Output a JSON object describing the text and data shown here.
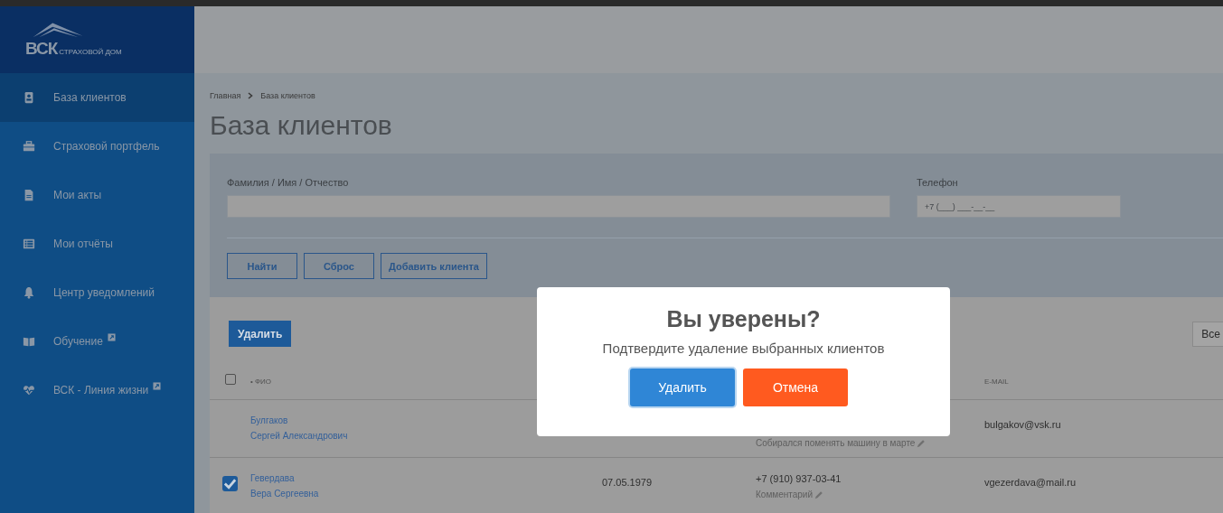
{
  "logo": {
    "mark": "ВСК",
    "subtitle": "СТРАХОВОЙ ДОМ"
  },
  "sidebar": {
    "items": [
      {
        "label": "База клиентов",
        "selected": true,
        "external": false
      },
      {
        "label": "Страховой портфель",
        "selected": false,
        "external": false
      },
      {
        "label": "Мои акты",
        "selected": false,
        "external": false
      },
      {
        "label": "Мои отчёты",
        "selected": false,
        "external": false
      },
      {
        "label": "Центр уведомлений",
        "selected": false,
        "external": false
      },
      {
        "label": "Обучение",
        "selected": false,
        "external": true
      },
      {
        "label": "ВСК - Линия жизни",
        "selected": false,
        "external": true
      }
    ]
  },
  "breadcrumb": [
    {
      "label": "Главная"
    },
    {
      "label": "База клиентов"
    }
  ],
  "page_title": "База клиентов",
  "filters": {
    "name": {
      "label": "Фамилия / Имя / Отчество"
    },
    "phone": {
      "label": "Телефон",
      "placeholder": "+7 (___) ___-__-__"
    },
    "buttons": [
      "Найти",
      "Сброс",
      "Добавить клиента"
    ]
  },
  "table": {
    "delete_button": "Удалить",
    "page_size": "Все",
    "select_all_checked": false,
    "columns": [
      {
        "label": "• ФИО"
      },
      {
        "label": "E-MAIL"
      }
    ],
    "rows": [
      {
        "checked": false,
        "surname": "Булгаков",
        "given_names": "Сергей Александрович",
        "comment": "Собирался поменять машину в марте",
        "email": "bulgakov@vsk.ru"
      },
      {
        "checked": true,
        "surname": "Гевердава",
        "given_names": "Вера Сергеевна",
        "birth_date": "07.05.1979",
        "phone": "+7 (910) 937-03-41",
        "comment": "Комментарий",
        "email": "vgezerdava@mail.ru"
      }
    ]
  },
  "dialog": {
    "title": "Вы уверены?",
    "message": "Подтвердите удаление выбранных клиентов",
    "confirm": "Удалить",
    "cancel": "Отмена"
  }
}
